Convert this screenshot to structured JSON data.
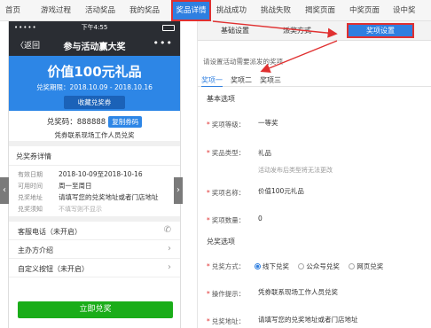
{
  "topnav": {
    "tabs": [
      {
        "label": "首页"
      },
      {
        "label": "游戏过程"
      },
      {
        "label": "活动奖品"
      },
      {
        "label": "我的奖品"
      },
      {
        "label": "奖品详情"
      },
      {
        "label": "挑战成功"
      },
      {
        "label": "挑战失败"
      },
      {
        "label": "揭奖页面"
      },
      {
        "label": "中奖页面"
      },
      {
        "label": "设中奖"
      }
    ],
    "active_index": 4
  },
  "phone": {
    "status": {
      "signal": "••••• ",
      "time": "下午4:55"
    },
    "header": {
      "back_label": "〈返回",
      "title": "参与活动赢大奖",
      "more": "•••"
    },
    "banner": {
      "prize": "价值100元礼品",
      "period": "兑奖期限：2018.10.09 - 2018.10.16",
      "collect_button": "收藏兑奖券"
    },
    "code": {
      "label": "兑奖码：888888",
      "copy_button": "复制券码",
      "tip": "凭券联系现场工作人员兑奖"
    },
    "details": {
      "title": "兑奖券详情",
      "rows": [
        {
          "key": "有效日期",
          "value": "2018-10-09至2018-10-16"
        },
        {
          "key": "可用时间",
          "value": "周一至周日"
        },
        {
          "key": "兑奖地址",
          "value": "请填写您的兑奖地址或者门店地址"
        },
        {
          "key": "兑奖须知",
          "value": "不填写则不显示"
        }
      ]
    },
    "list": [
      {
        "label": "客服电话（未开启）"
      },
      {
        "label": "主办方介绍"
      },
      {
        "label": "自定义按钮（未开启）"
      }
    ],
    "redeem_button": "立即兑奖"
  },
  "panel": {
    "sub_tabs": [
      {
        "label": "基础设置"
      },
      {
        "label": "派奖方式"
      },
      {
        "label": "奖项设置"
      }
    ],
    "active_sub_tab": 2,
    "hint": "请设置活动需要派发的奖项",
    "prize_tabs": [
      {
        "label": "奖项一"
      },
      {
        "label": "奖项二"
      },
      {
        "label": "奖项三"
      }
    ],
    "basic_section": "基本选项",
    "fields": {
      "level": {
        "label": "奖项等级：",
        "value": "一等奖"
      },
      "type": {
        "label": "奖品类型：",
        "value": "礼品",
        "note": "活动发布后类型将无法更改"
      },
      "name": {
        "label": "奖项名称：",
        "value": "价值100元礼品"
      },
      "quantity": {
        "label": "奖项数量：",
        "value": "0"
      }
    },
    "redeem_section": "兑奖选项",
    "redeem_method": {
      "label": "兑奖方式：",
      "options": [
        {
          "label": "线下兑奖",
          "selected": true
        },
        {
          "label": "公众号兑奖",
          "selected": false
        },
        {
          "label": "网页兑奖",
          "selected": false
        }
      ]
    },
    "operation_tip": {
      "label": "操作提示：",
      "value": "凭券联系现场工作人员兑奖"
    },
    "redeem_address": {
      "label": "兑奖地址：",
      "value": "请填写您的兑奖地址或者门店地址"
    }
  },
  "colors": {
    "accent": "#2f7fe0",
    "banner": "#2d86e6",
    "green": "#1aad19",
    "highlight": "#e03030",
    "dark": "#2a2d33"
  }
}
